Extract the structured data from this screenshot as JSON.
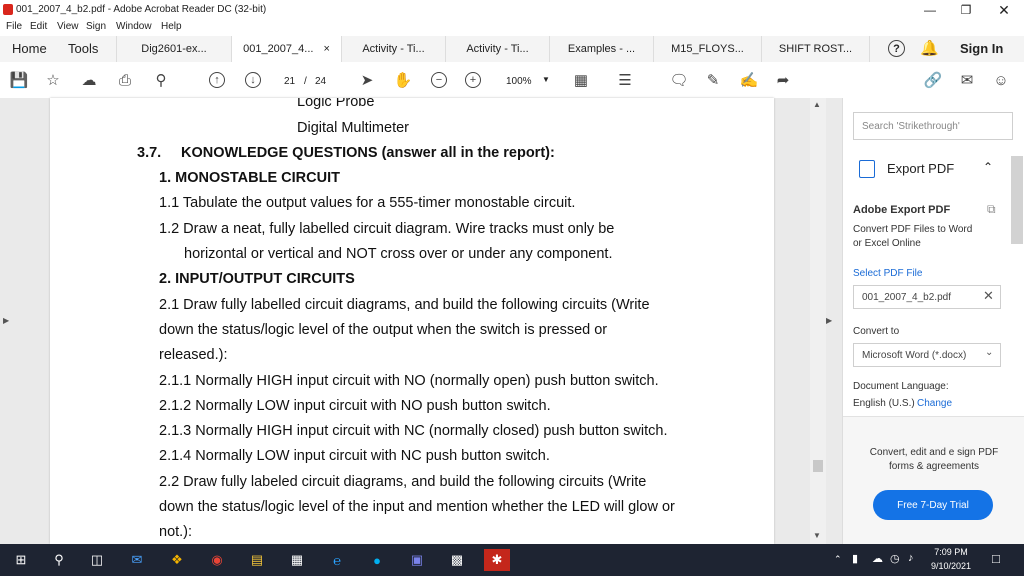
{
  "window": {
    "title": "001_2007_4_b2.pdf - Adobe Acrobat Reader DC (32-bit)"
  },
  "menu": [
    "File",
    "Edit",
    "View",
    "Sign",
    "Window",
    "Help"
  ],
  "nav": {
    "home": "Home",
    "tools": "Tools",
    "sign_in": "Sign In"
  },
  "tabs": [
    {
      "label": "Dig2601-ex..."
    },
    {
      "label": "001_2007_4...",
      "close": "×"
    },
    {
      "label": "Activity - Ti..."
    },
    {
      "label": "Activity - Ti..."
    },
    {
      "label": "Examples - ..."
    },
    {
      "label": "M15_FLOYS..."
    },
    {
      "label": "SHIFT ROST..."
    }
  ],
  "toolbar": {
    "page_current": "21",
    "page_sep": "/",
    "page_total": "24",
    "zoom": "100%"
  },
  "document": {
    "lines": [
      "Logic Probe",
      "Digital Multimeter",
      "3.7.",
      "KONOWLEDGE QUESTIONS (answer all in the report):",
      "1.  MONOSTABLE CIRCUIT",
      "1.1 Tabulate the output values for a 555-timer monostable circuit.",
      "1.2  Draw a neat, fully labelled circuit diagram. Wire tracks must only be",
      "horizontal or vertical and NOT cross over or under any component.",
      "2. INPUT/OUTPUT CIRCUITS",
      "2.1 Draw fully labelled circuit diagrams, and build the following circuits (Write",
      "down the status/logic level of the output when the switch is pressed or",
      "released.):",
      "2.1.1 Normally HIGH input circuit with NO (normally open) push button switch.",
      "2.1.2 Normally LOW input circuit with NO push button switch.",
      "2.1.3 Normally HIGH input circuit with NC (normally closed) push button switch.",
      "2.1.4 Normally LOW input circuit with NC push button switch.",
      "2.2 Draw fully labeled circuit diagrams, and build the following circuits (Write",
      "down the status/logic level of the input and mention whether the LED will glow or",
      "not.):"
    ]
  },
  "panel": {
    "search_placeholder": "Search 'Strikethrough'",
    "export_label": "Export PDF",
    "heading": "Adobe Export PDF",
    "desc1": "Convert PDF Files to Word",
    "desc2": "or Excel Online",
    "select_file": "Select PDF File",
    "file_name": "001_2007_4_b2.pdf",
    "convert_to": "Convert to",
    "format": "Microsoft Word (*.docx)",
    "doc_lang_label": "Document Language:",
    "doc_lang_value": "English (U.S.)",
    "change": "Change",
    "promo1": "Convert, edit and e sign PDF",
    "promo2": "forms & agreements",
    "trial_button": "Free 7-Day Trial"
  },
  "taskbar": {
    "time": "7:09 PM",
    "date": "9/10/2021"
  },
  "colors": {
    "accent": "#1a6bd6",
    "trial": "#1473e6",
    "acrobat_red": "#d9261c",
    "taskbar": "#1e2432"
  }
}
